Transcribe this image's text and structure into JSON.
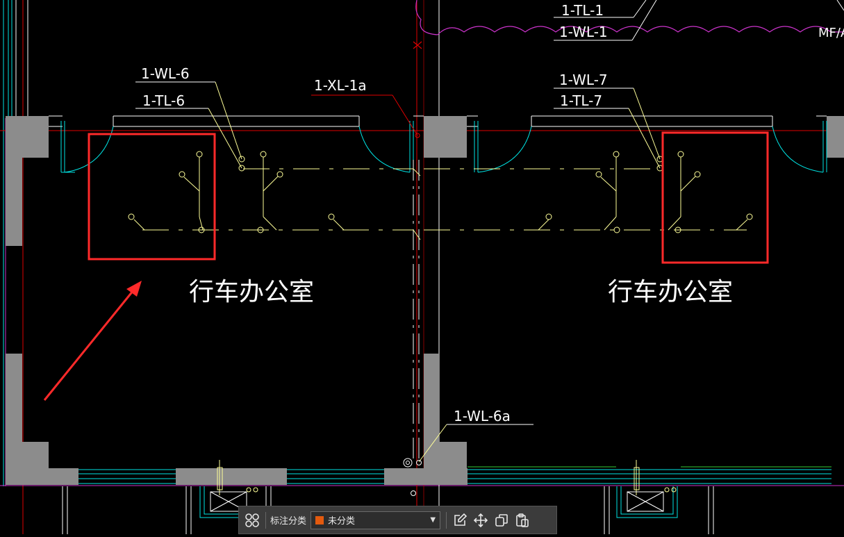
{
  "drawing": {
    "labels": {
      "tl1": "1-TL-1",
      "wl1": "1-WL-1",
      "mf": "MF/A",
      "wl6": "1-WL-6",
      "tl6": "1-TL-6",
      "xl1a": "1-XL-1a",
      "wl7": "1-WL-7",
      "tl7": "1-TL-7",
      "wl6a": "1-WL-6a"
    },
    "rooms": {
      "left": "行车办公室",
      "right": "行车办公室"
    },
    "colors": {
      "wall_fill": "#8c8c8c",
      "yellow": "#ffff99",
      "cyan": "#00e5e5",
      "red": "#e00000",
      "magenta": "#cc33cc",
      "white": "#ffffff",
      "highlight": "#ff2a2a",
      "green": "#33cc33"
    }
  },
  "toolbar": {
    "category_label": "标注分类",
    "category_value": "未分类",
    "category_color": "#e45a0e",
    "icons": [
      "grid-icon",
      "edit-icon",
      "move-icon",
      "copy-icon",
      "paste-icon"
    ]
  }
}
